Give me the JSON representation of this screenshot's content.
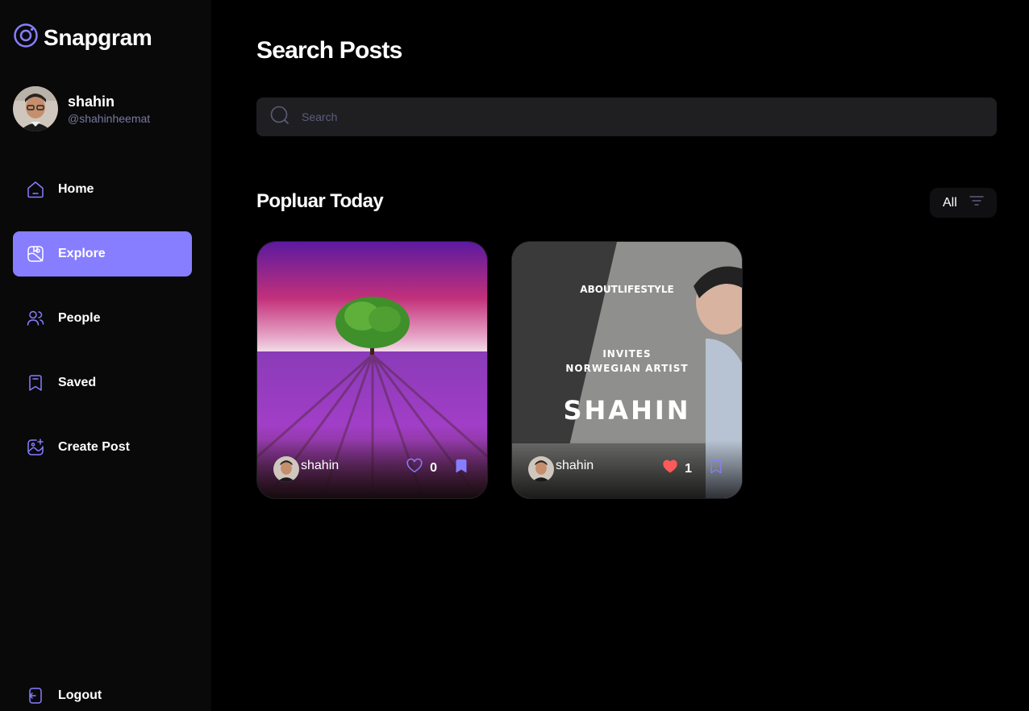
{
  "app": {
    "name": "Snapgram"
  },
  "profile": {
    "name": "shahin",
    "handle": "@shahinheemat"
  },
  "nav": [
    {
      "label": "Home",
      "icon": "home-icon",
      "active": false
    },
    {
      "label": "Explore",
      "icon": "explore-icon",
      "active": true
    },
    {
      "label": "People",
      "icon": "people-icon",
      "active": false
    },
    {
      "label": "Saved",
      "icon": "bookmark-icon",
      "active": false
    },
    {
      "label": "Create Post",
      "icon": "gallery-add-icon",
      "active": false
    }
  ],
  "logout": {
    "label": "Logout"
  },
  "page": {
    "title": "Search Posts"
  },
  "search": {
    "placeholder": "Search",
    "value": ""
  },
  "section": {
    "title": "Popluar Today"
  },
  "filter": {
    "label": "All"
  },
  "posts": [
    {
      "user": "shahin",
      "likes": "0",
      "liked": false,
      "saved": true,
      "image": "lavender field with tree"
    },
    {
      "user": "shahin",
      "likes": "1",
      "liked": true,
      "saved": false,
      "image": "poster",
      "poster": {
        "line1": "ABOUTLIFESTYLE",
        "line2": "INVITES",
        "line3": "NORWEGIAN ARTIST",
        "line4": "SHAHIN"
      }
    }
  ],
  "colors": {
    "accent": "#877EFF",
    "like": "#FF5A5A",
    "muted": "#7878A3",
    "input_bg": "#1F1F22"
  }
}
